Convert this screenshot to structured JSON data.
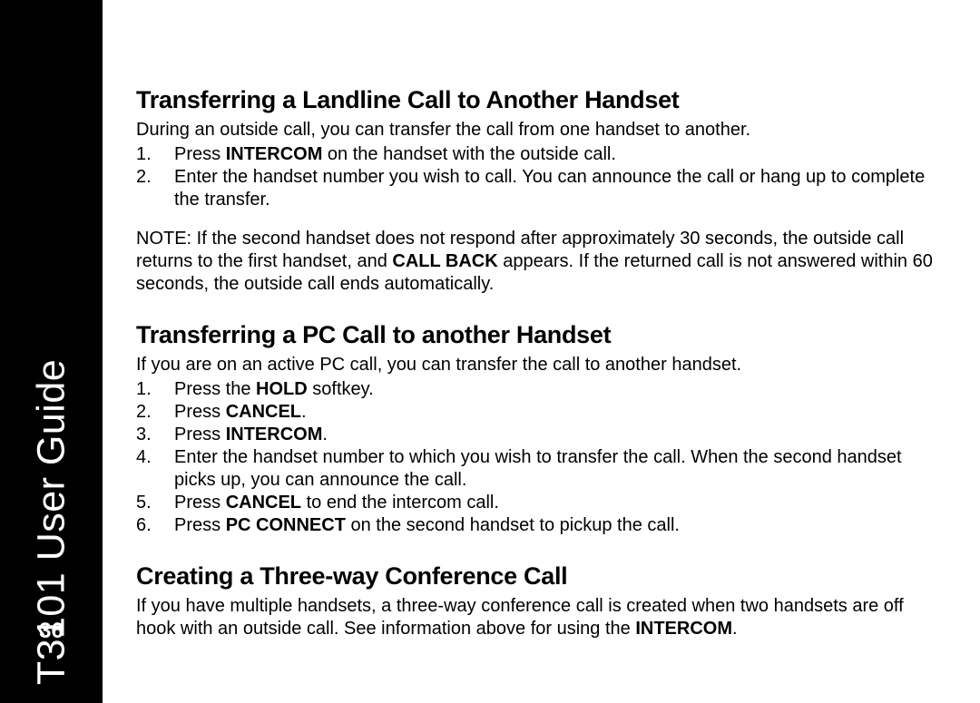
{
  "sidebar": {
    "title": "T3101 User Guide",
    "page_number": "36"
  },
  "sections": [
    {
      "heading": "Transferring a Landline Call to Another Handset",
      "intro": "During an outside call, you can transfer the call from one handset to another.",
      "steps": [
        {
          "pre": "Press ",
          "bold": "INTERCOM",
          "post": " on the handset with the outside call."
        },
        {
          "pre": "Enter the handset number you wish to call. You can announce the call or hang up to complete the transfer.",
          "bold": "",
          "post": ""
        }
      ],
      "note": {
        "pre": "NOTE: If the second handset does not respond after approximately 30 seconds, the outside call returns to the first handset, and ",
        "bold": "CALL BACK",
        "post": " appears. If the returned call is not answered within 60 seconds, the outside call ends automatically."
      }
    },
    {
      "heading": "Transferring a PC Call to another Handset",
      "intro": "If you are on an active PC call, you can transfer the call to another handset.",
      "steps": [
        {
          "pre": "Press the ",
          "bold": "HOLD",
          "post": " softkey."
        },
        {
          "pre": "Press ",
          "bold": "CANCEL",
          "post": "."
        },
        {
          "pre": "Press ",
          "bold": "INTERCOM",
          "post": "."
        },
        {
          "pre": "Enter the handset number to which you wish to transfer the call. When the second handset picks up, you can announce the call.",
          "bold": "",
          "post": ""
        },
        {
          "pre": "Press ",
          "bold": "CANCEL",
          "post": " to end the intercom call."
        },
        {
          "pre": "Press ",
          "bold": "PC CONNECT",
          "post": " on the second handset to pickup the call."
        }
      ]
    },
    {
      "heading": "Creating a Three-way Conference Call",
      "intro_rich": {
        "pre": "If you have multiple handsets, a three-way conference call is created when two handsets are off hook with an outside call. See information above for using the ",
        "bold": "INTERCOM",
        "post": "."
      }
    }
  ]
}
